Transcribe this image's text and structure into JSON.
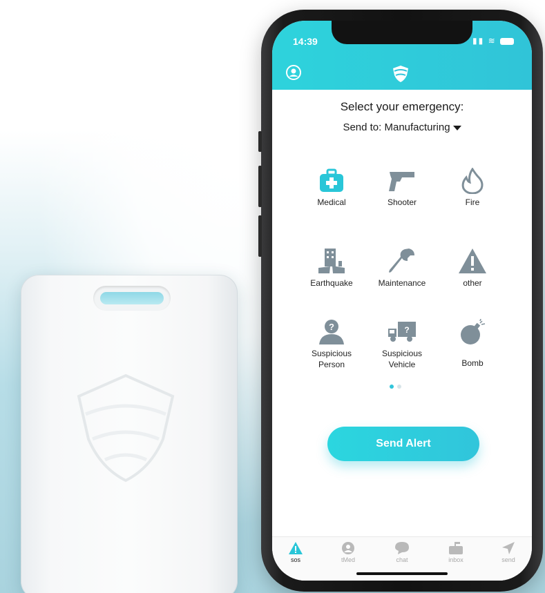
{
  "status": {
    "time": "14:39"
  },
  "header": {
    "profile_icon": "profile-icon",
    "logo_icon": "shield-logo-icon"
  },
  "main": {
    "title": "Select your emergency:",
    "send_to_label": "Send to: Manufacturing",
    "emergencies": [
      {
        "label": "Medical",
        "icon": "medical-kit-icon",
        "color": "#29c6d8"
      },
      {
        "label": "Shooter",
        "icon": "gun-icon",
        "color": "#7f8f99"
      },
      {
        "label": "Fire",
        "icon": "fire-icon",
        "color": "#7f8f99"
      },
      {
        "label": "Earthquake",
        "icon": "earthquake-icon",
        "color": "#7f8f99"
      },
      {
        "label": "Maintenance",
        "icon": "wrench-icon",
        "color": "#7f8f99"
      },
      {
        "label": "other",
        "icon": "warning-icon",
        "color": "#7f8f99"
      },
      {
        "label": "Suspicious Person",
        "icon": "suspicious-person-icon",
        "color": "#7f8f99"
      },
      {
        "label": "Suspicious Vehicle",
        "icon": "suspicious-vehicle-icon",
        "color": "#7f8f99"
      },
      {
        "label": "Bomb",
        "icon": "bomb-icon",
        "color": "#7f8f99"
      }
    ],
    "page_indicator": {
      "current": 1,
      "total": 2
    },
    "send_button": "Send Alert"
  },
  "tabbar": {
    "items": [
      {
        "label": "sos",
        "icon": "sos-alert-icon",
        "active": true
      },
      {
        "label": "tMed",
        "icon": "tmed-icon",
        "active": false
      },
      {
        "label": "chat",
        "icon": "chat-icon",
        "active": false
      },
      {
        "label": "inbox",
        "icon": "inbox-icon",
        "active": false
      },
      {
        "label": "send",
        "icon": "send-icon",
        "active": false
      }
    ]
  },
  "colors": {
    "accent": "#2ed3dc",
    "icon_gray": "#7f8f99",
    "text": "#1b1b1b"
  }
}
